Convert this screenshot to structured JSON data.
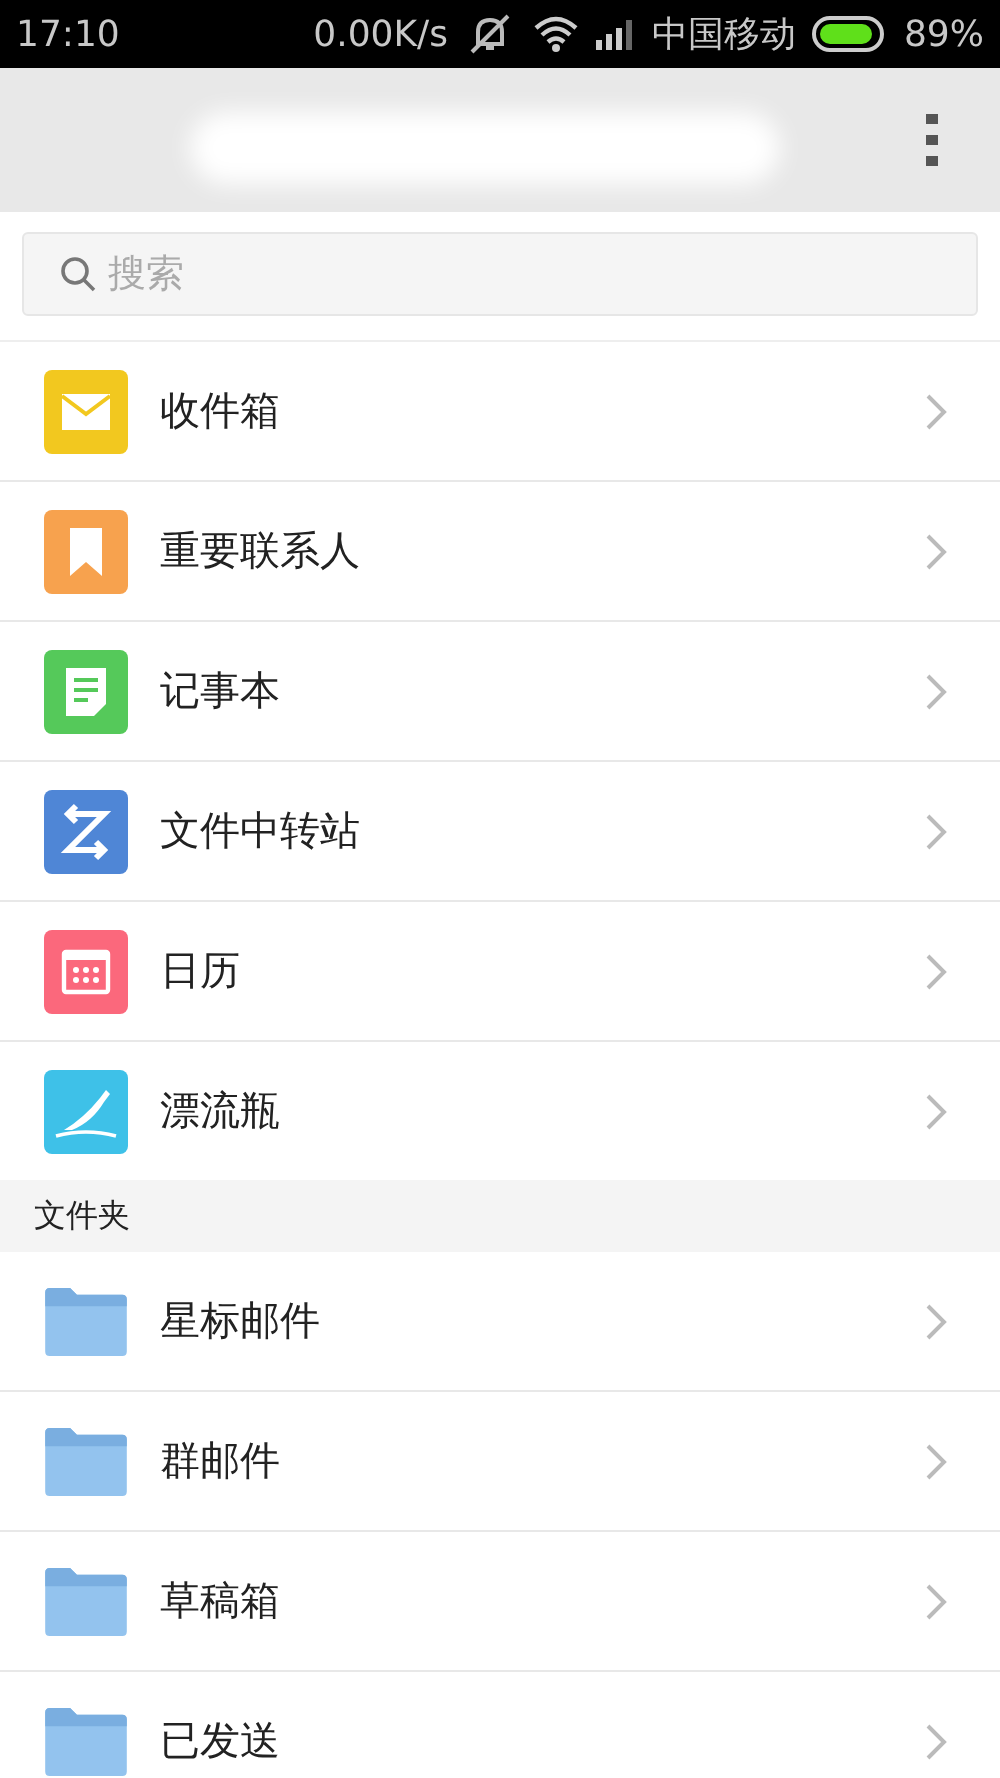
{
  "status_bar": {
    "time": "17:10",
    "speed": "0.00K/s",
    "carrier": "中国移动",
    "battery": "89%"
  },
  "search": {
    "placeholder": "搜索"
  },
  "apps": [
    {
      "label": "收件箱",
      "color": "#f2c81f"
    },
    {
      "label": "重要联系人",
      "color": "#f7a24e"
    },
    {
      "label": "记事本",
      "color": "#55c95a"
    },
    {
      "label": "文件中转站",
      "color": "#4f86d6"
    },
    {
      "label": "日历",
      "color": "#fb687c"
    },
    {
      "label": "漂流瓶",
      "color": "#3ec1e8"
    }
  ],
  "folders_section": {
    "title": "文件夹",
    "items": [
      {
        "label": "星标邮件"
      },
      {
        "label": "群邮件"
      },
      {
        "label": "草稿箱"
      },
      {
        "label": "已发送"
      }
    ]
  }
}
